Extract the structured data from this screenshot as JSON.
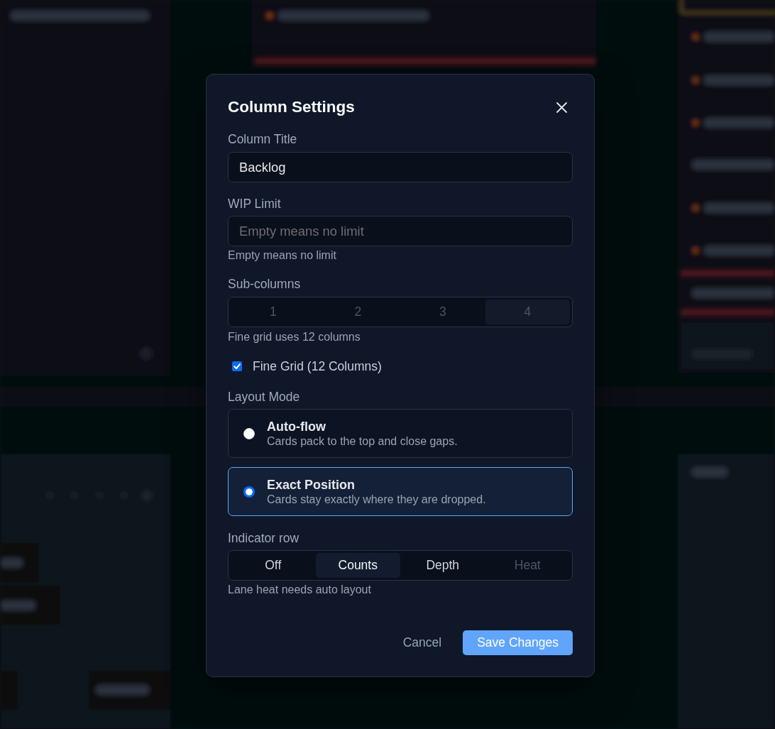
{
  "dialog": {
    "title": "Column Settings",
    "column_title": {
      "label": "Column Title",
      "value": "Backlog"
    },
    "wip_limit": {
      "label": "WIP Limit",
      "placeholder": "Empty means no limit",
      "hint": "Empty means no limit"
    },
    "sub_columns": {
      "label": "Sub-columns",
      "disabled": true,
      "options": [
        {
          "label": "1",
          "selected": false
        },
        {
          "label": "2",
          "selected": false
        },
        {
          "label": "3",
          "selected": false
        },
        {
          "label": "4",
          "selected": true
        }
      ],
      "hint": "Fine grid uses 12 columns"
    },
    "fine_grid": {
      "label": "Fine Grid (12 Columns)",
      "checked": true
    },
    "layout_mode": {
      "label": "Layout Mode",
      "options": [
        {
          "title": "Auto-flow",
          "description": "Cards pack to the top and close gaps.",
          "selected": false
        },
        {
          "title": "Exact Position",
          "description": "Cards stay exactly where they are dropped.",
          "selected": true
        }
      ]
    },
    "indicator_row": {
      "label": "Indicator row",
      "options": [
        {
          "label": "Off",
          "selected": false,
          "disabled": false
        },
        {
          "label": "Counts",
          "selected": true,
          "disabled": false
        },
        {
          "label": "Depth",
          "selected": false,
          "disabled": false
        },
        {
          "label": "Heat",
          "selected": false,
          "disabled": true
        }
      ],
      "hint": "Lane heat needs auto layout"
    },
    "buttons": [
      {
        "label": "Cancel",
        "kind": "secondary"
      },
      {
        "label": "Save Changes",
        "kind": "primary"
      }
    ]
  }
}
